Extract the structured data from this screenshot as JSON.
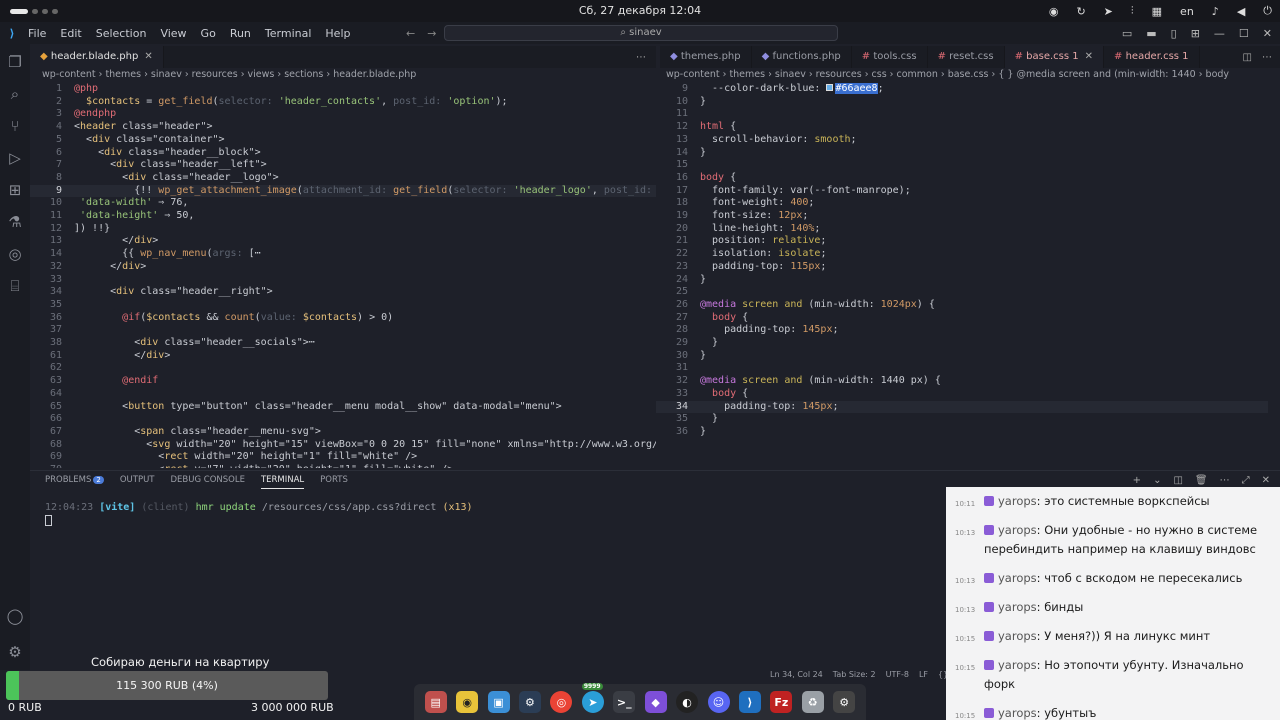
{
  "system_bar": {
    "datetime": "Сб, 27 декабря 12:04",
    "tray": [
      "obs-icon",
      "refresh-icon",
      "telegram-icon",
      "mixer-icon",
      "grid-icon"
    ],
    "lang": "en"
  },
  "titlebar": {
    "menu": [
      "File",
      "Edit",
      "Selection",
      "View",
      "Go",
      "Run",
      "Terminal",
      "Help"
    ],
    "search": "sinaev"
  },
  "left_editor": {
    "tab": "header.blade.php",
    "breadcrumb": "wp-content  ›  themes  ›  sinaev  ›  resources  ›  views  ›  sections  ›  header.blade.php",
    "lines": [
      {
        "n": "1",
        "t": "@php"
      },
      {
        "n": "2",
        "t": "  $contacts = get_field(selector: 'header_contacts', post_id: 'option');"
      },
      {
        "n": "3",
        "t": "@endphp"
      },
      {
        "n": "4",
        "t": "<header class=\"header\">"
      },
      {
        "n": "5",
        "t": "  <div class=\"container\">"
      },
      {
        "n": "6",
        "t": "    <div class=\"header__block\">"
      },
      {
        "n": "7",
        "t": "      <div class=\"header__left\">"
      },
      {
        "n": "8",
        "t": "        <div class=\"header__logo\">"
      },
      {
        "n": "9",
        "t": "          {!! wp_get_attachment_image(attachment_id: get_field(selector: 'header_logo', post_id: 'op"
      },
      {
        "n": "10",
        "t": " 'data-width' ⇒ 76,"
      },
      {
        "n": "11",
        "t": " 'data-height' ⇒ 50,"
      },
      {
        "n": "12",
        "t": "]) !!}"
      },
      {
        "n": "13",
        "t": "        </div>"
      },
      {
        "n": "14",
        "t": "        {{ wp_nav_menu(args: [⋯"
      },
      {
        "n": "32",
        "t": "      </div>"
      },
      {
        "n": "33",
        "t": ""
      },
      {
        "n": "34",
        "t": "      <div class=\"header__right\">"
      },
      {
        "n": "35",
        "t": ""
      },
      {
        "n": "36",
        "t": "        @if($contacts && count(value: $contacts) > 0)"
      },
      {
        "n": "37",
        "t": ""
      },
      {
        "n": "38",
        "t": "          <div class=\"header__socials\">⋯"
      },
      {
        "n": "61",
        "t": "          </div>"
      },
      {
        "n": "62",
        "t": ""
      },
      {
        "n": "63",
        "t": "        @endif"
      },
      {
        "n": "64",
        "t": ""
      },
      {
        "n": "65",
        "t": "        <button type=\"button\" class=\"header__menu modal__show\" data-modal=\"menu\">"
      },
      {
        "n": "66",
        "t": ""
      },
      {
        "n": "67",
        "t": "          <span class=\"header__menu-svg\">"
      },
      {
        "n": "68",
        "t": "            <svg width=\"20\" height=\"15\" viewBox=\"0 0 20 15\" fill=\"none\" xmlns=\"http://www.w3.org/200"
      },
      {
        "n": "69",
        "t": "              <rect width=\"20\" height=\"1\" fill=\"white\" />"
      },
      {
        "n": "70",
        "t": "              <rect y=\"7\" width=\"20\" height=\"1\" fill=\"white\" />"
      }
    ]
  },
  "right_editor": {
    "tabs": [
      "themes.php",
      "functions.php",
      "tools.css",
      "reset.css",
      "base.css 1",
      "header.css 1"
    ],
    "active_tab": "base.css 1",
    "breadcrumb": "wp-content  ›  themes  ›  sinaev  ›  resources  ›  css  ›  common  ›  base.css  ›  { } @media screen and (min-width: 1440  ›  body",
    "color_value": "#66aee8",
    "lines": [
      {
        "n": "9",
        "t": "  --color-dark-blue: "
      },
      {
        "n": "10",
        "t": "}"
      },
      {
        "n": "11",
        "t": ""
      },
      {
        "n": "12",
        "t": "html {"
      },
      {
        "n": "13",
        "t": "  scroll-behavior: smooth;"
      },
      {
        "n": "14",
        "t": "}"
      },
      {
        "n": "15",
        "t": ""
      },
      {
        "n": "16",
        "t": "body {"
      },
      {
        "n": "17",
        "t": "  font-family: var(--font-manrope);"
      },
      {
        "n": "18",
        "t": "  font-weight: 400;"
      },
      {
        "n": "19",
        "t": "  font-size: 12px;"
      },
      {
        "n": "20",
        "t": "  line-height: 140%;"
      },
      {
        "n": "21",
        "t": "  position: relative;"
      },
      {
        "n": "22",
        "t": "  isolation: isolate;"
      },
      {
        "n": "23",
        "t": "  padding-top: 115px;"
      },
      {
        "n": "24",
        "t": "}"
      },
      {
        "n": "25",
        "t": ""
      },
      {
        "n": "26",
        "t": "@media screen and (min-width: 1024px) {"
      },
      {
        "n": "27",
        "t": "  body {"
      },
      {
        "n": "28",
        "t": "    padding-top: 145px;"
      },
      {
        "n": "29",
        "t": "  }"
      },
      {
        "n": "30",
        "t": "}"
      },
      {
        "n": "31",
        "t": ""
      },
      {
        "n": "32",
        "t": "@media screen and (min-width: 1440 px) {"
      },
      {
        "n": "33",
        "t": "  body {"
      },
      {
        "n": "34",
        "t": "    padding-top: 145px;"
      },
      {
        "n": "35",
        "t": "  }"
      },
      {
        "n": "36",
        "t": "}"
      }
    ]
  },
  "panel": {
    "tabs": [
      "PROBLEMS",
      "OUTPUT",
      "DEBUG CONSOLE",
      "TERMINAL",
      "PORTS"
    ],
    "active_tab": "TERMINAL",
    "problems_count": "2",
    "terminal_line": {
      "time": "12:04:23",
      "tag": "[vite]",
      "scope": "(client)",
      "msg": "hmr update",
      "path": "/resources/css/app.css?direct",
      "count": "(x13)"
    }
  },
  "status_bar": {
    "position": "Ln 34, Col 24",
    "tab_size": "Tab Size: 2",
    "encoding": "UTF-8",
    "eol": "LF",
    "lang": "{} P"
  },
  "chat": [
    {
      "time": "10:11",
      "user": "yarops",
      "text": "это системные воркспейсы"
    },
    {
      "time": "10:13",
      "user": "yarops",
      "text": "Они удобные - но нужно в системе перебиндить например на клавишу виндовс"
    },
    {
      "time": "10:13",
      "user": "yarops",
      "text": "чтоб с вскодом не пересекались"
    },
    {
      "time": "10:13",
      "user": "yarops",
      "text": "бинды"
    },
    {
      "time": "10:15",
      "user": "yarops",
      "text": "У меня?)) Я на линукс минт"
    },
    {
      "time": "10:15",
      "user": "yarops",
      "text": "Но этопочти убунту. Изначально форк"
    },
    {
      "time": "10:15",
      "user": "yarops",
      "text": "убунтыъ"
    }
  ],
  "donation": {
    "title": "Собираю деньги на квартиру",
    "progress_label": "115 300 RUB (4%)",
    "progress": 0.04,
    "min_label": "0 RUB",
    "max_label": "3 000 000 RUB",
    "color": "#4cc45a"
  },
  "dock": {
    "badge": "9999",
    "apps": [
      "files-icon",
      "settings-icon",
      "store-icon",
      "steam-icon",
      "chrome-icon",
      "telegram-icon",
      "terminal-icon",
      "obsidian-icon",
      "obs-icon",
      "discord-icon",
      "vscode-icon",
      "filezilla-icon",
      "trash-icon",
      "gear-icon"
    ]
  }
}
